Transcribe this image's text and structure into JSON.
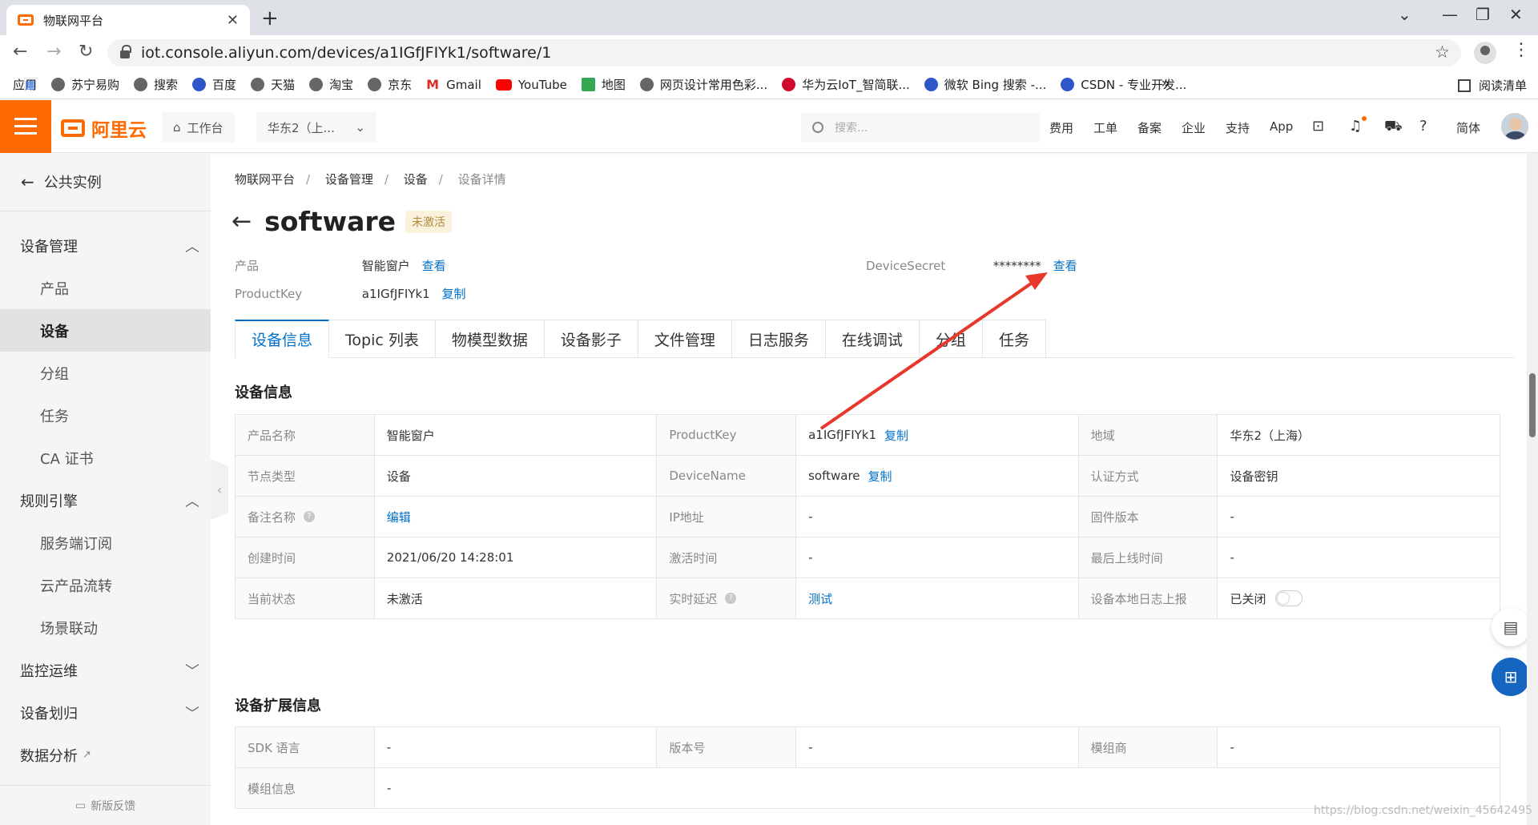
{
  "browser": {
    "tab_title": "物联网平台",
    "url": "iot.console.aliyun.com/devices/a1IGfJFIYk1/software/1",
    "bookmarks": [
      "应用",
      "苏宁易购",
      "搜索",
      "百度",
      "天猫",
      "淘宝",
      "京东",
      "Gmail",
      "YouTube",
      "地图",
      "网页设计常用色彩...",
      "华为云IoT_智简联...",
      "微软 Bing 搜索 -...",
      "CSDN - 专业开发..."
    ],
    "reading_list": "阅读清单",
    "more": "»"
  },
  "header": {
    "logo_text": "阿里云",
    "workbench": "工作台",
    "region": "华东2（上...",
    "search_placeholder": "搜索...",
    "links": [
      "费用",
      "工单",
      "备案",
      "企业",
      "支持",
      "App"
    ],
    "lang": "简体"
  },
  "sidebar": {
    "back_label": "公共实例",
    "groups": [
      {
        "label": "设备管理",
        "items": [
          "产品",
          "设备",
          "分组",
          "任务",
          "CA 证书"
        ]
      },
      {
        "label": "规则引擎",
        "items": [
          "服务端订阅",
          "云产品流转",
          "场景联动"
        ]
      },
      {
        "label": "监控运维",
        "items": []
      },
      {
        "label": "设备划归",
        "items": []
      },
      {
        "label": "数据分析",
        "items": []
      }
    ],
    "feedback": "新版反馈"
  },
  "main": {
    "breadcrumb": [
      "物联网平台",
      "设备管理",
      "设备",
      "设备详情"
    ],
    "device_name": "software",
    "status_badge": "未激活",
    "meta": {
      "product_label": "产品",
      "product_value": "智能窗户",
      "product_link": "查看",
      "productkey_label": "ProductKey",
      "productkey_value": "a1IGfJFIYk1",
      "productkey_link": "复制",
      "secret_label": "DeviceSecret",
      "secret_value": "********",
      "secret_link": "查看"
    },
    "tabs": [
      "设备信息",
      "Topic 列表",
      "物模型数据",
      "设备影子",
      "文件管理",
      "日志服务",
      "在线调试",
      "分组",
      "任务"
    ],
    "section1_title": "设备信息",
    "info_rows": [
      [
        {
          "k": "产品名称",
          "v": "智能窗户"
        },
        {
          "k": "ProductKey",
          "v": "a1IGfJFIYk1",
          "link": "复制"
        },
        {
          "k": "地域",
          "v": "华东2（上海）"
        }
      ],
      [
        {
          "k": "节点类型",
          "v": "设备"
        },
        {
          "k": "DeviceName",
          "v": "software",
          "link": "复制"
        },
        {
          "k": "认证方式",
          "v": "设备密钥"
        }
      ],
      [
        {
          "k": "备注名称",
          "v": "编辑"
        },
        {
          "k": "IP地址",
          "v": "-"
        },
        {
          "k": "固件版本",
          "v": "-"
        }
      ],
      [
        {
          "k": "创建时间",
          "v": "2021/06/20 14:28:01"
        },
        {
          "k": "激活时间",
          "v": "-"
        },
        {
          "k": "最后上线时间",
          "v": "-"
        }
      ],
      [
        {
          "k": "当前状态",
          "v": "未激活"
        },
        {
          "k": "实时延迟",
          "v": "测试"
        },
        {
          "k": "设备本地日志上报",
          "v": "已关闭"
        }
      ]
    ],
    "section2_title": "设备扩展信息",
    "ext_rows": [
      [
        {
          "k": "SDK 语言",
          "v": "-"
        },
        {
          "k": "版本号",
          "v": "-"
        },
        {
          "k": "模组商",
          "v": "-"
        }
      ],
      [
        {
          "k": "模组信息",
          "v": "-"
        }
      ]
    ]
  },
  "watermark": "https://blog.csdn.net/weixin_45642495",
  "colors": {
    "brand": "#ff6a00",
    "link": "#0070cc",
    "annotation": "#e8372b"
  }
}
